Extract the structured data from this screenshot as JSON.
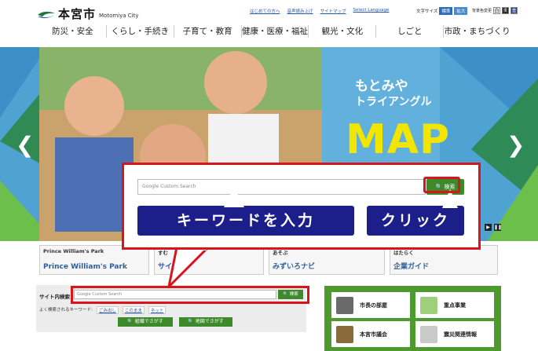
{
  "header": {
    "logo_text": "本宮市",
    "logo_sub": "Motomiya City",
    "util_links": [
      "はじめての方へ",
      "音声読み上げ",
      "サイトマップ",
      "Select Language"
    ],
    "fontsize_label": "文字サイズ",
    "fontsize_standard": "標準",
    "fontsize_large": "拡大",
    "color_label": "背景色変更",
    "color_white": "白",
    "color_black": "黒",
    "color_blue": "青"
  },
  "gnav": [
    "防災・安全",
    "くらし・手続き",
    "子育て・教育",
    "健康・医療・福祉",
    "観光・文化",
    "しごと",
    "市政・まちづくり"
  ],
  "hero": {
    "prev_arrow": "❮",
    "next_arrow": "❯",
    "title_line1": "もとみや",
    "title_line2": "トライアングル",
    "title_big": "MAP",
    "play_icon": "▶",
    "pause_icon": "❚❚"
  },
  "banners": [
    {
      "label": "Prince William's Park",
      "main": "Prince William's Park"
    },
    {
      "label": "すむ",
      "main": "サイト"
    },
    {
      "label": "あそぶ",
      "main": "みずいろナビ"
    },
    {
      "label": "はたらく",
      "main": "企業ガイド"
    }
  ],
  "site_search": {
    "label": "サイト内検索",
    "placeholder": "Google Custom Search",
    "button": "検索",
    "freq_label": "よく検索されるキーワード:",
    "keywords": [
      "ごみ出し",
      "このまま",
      "ネット"
    ],
    "org_button": "組織でさがす",
    "map_button": "地図でさがす"
  },
  "quick_links": [
    "市長の部屋",
    "重点事業",
    "本宮市議会",
    "震災関連情報"
  ],
  "callout": {
    "placeholder": "Google Custom Search",
    "button": "検索",
    "instruction_left": "キーワードを入力",
    "instruction_right": "クリック"
  },
  "colors": {
    "accent_green": "#3d8a2a",
    "highlight_red": "#d8141c",
    "instruction_navy": "#1c1f8a"
  }
}
